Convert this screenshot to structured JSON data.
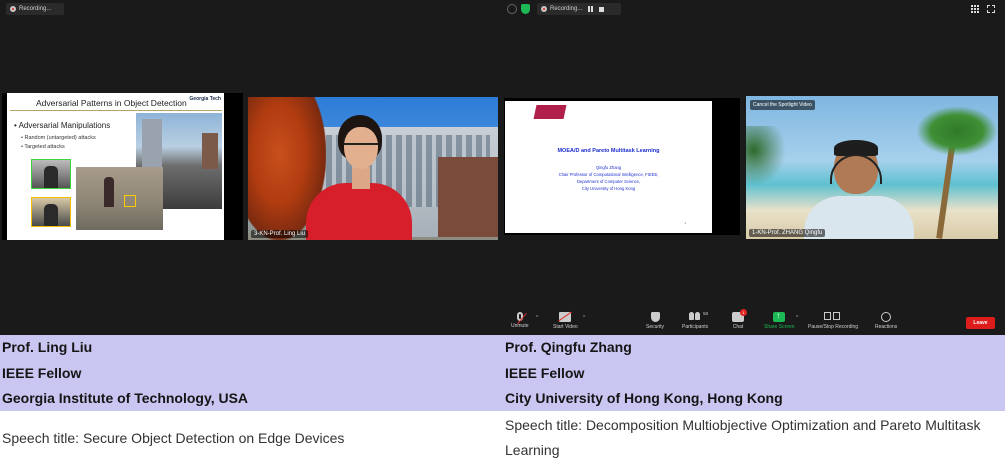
{
  "zoom": {
    "recording_label_left": "Recording...",
    "recording_label_center": "Recording...",
    "tiles": [
      {
        "type": "slide",
        "slide": {
          "title": "Adversarial Patterns in Object Detection",
          "logo": "Georgia Tech",
          "bullet": "Adversarial Manipulations",
          "sub_bullets": [
            "Random (untargeted) attacks",
            "Targeted attacks"
          ]
        }
      },
      {
        "type": "video",
        "name_tag": "3-KN-Prof. Ling Liu"
      },
      {
        "type": "slide",
        "slide": {
          "title": "MOEA/D and Pareto Multitask Learning",
          "lines": [
            "Qingfu Zhang",
            "Chair Professor of Computational Intelligence, FIEEE,",
            "Department of Computer Science,",
            "City University of Hong Kong"
          ],
          "page": "1"
        }
      },
      {
        "type": "video",
        "name_tag": "1-KN-Prof. ZHANG Qingfu",
        "spotlight": "Cancel the Spotlight Video"
      }
    ],
    "controls": {
      "unmute": "Unmute",
      "start_video": "Start Video",
      "security": "Security",
      "participants": "Participants",
      "participants_count": "50",
      "chat": "Chat",
      "chat_badge": "1",
      "share_screen": "Share Screen",
      "pause_stop_recording": "Pause/Stop Recording",
      "reactions": "Reactions",
      "leave": "Leave"
    },
    "colors": {
      "share_green": "#1db954",
      "leave_red": "#dd1c1c",
      "background": "#1a1a1a"
    }
  },
  "speakers": [
    {
      "name": "Prof. Ling Liu",
      "title": "IEEE Fellow",
      "affiliation": "Georgia Institute of Technology, USA",
      "speech": "Speech title: Secure Object Detection on Edge Devices"
    },
    {
      "name": "Prof. Qingfu Zhang",
      "title": "IEEE Fellow",
      "affiliation": "City University of Hong Kong, Hong Kong",
      "speech": "Speech title: Decomposition Multiobjective Optimization and Pareto Multitask Learning"
    }
  ],
  "colors": {
    "header_bg": "#c9c6f2"
  }
}
